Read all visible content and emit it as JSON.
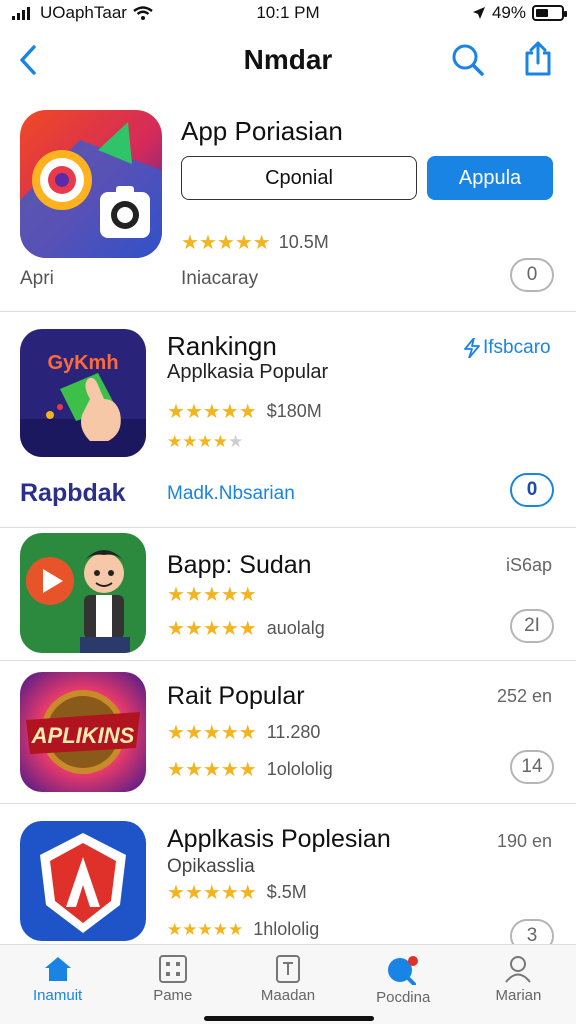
{
  "status_bar": {
    "carrier": "UOaphTaar",
    "time": "10:1 PM",
    "battery_percent": "49%",
    "battery_level": 0.49
  },
  "nav": {
    "title": "Nmdar",
    "back_icon": "chevron-left-icon",
    "search_icon": "search-icon",
    "share_icon": "share-icon"
  },
  "featured": {
    "title": "App Poriasian",
    "secondary_button": "Cponial",
    "primary_button": "Appula",
    "rating": 4.5,
    "size": "10.5M",
    "caption": "Apri",
    "category": "Iniacaray",
    "badge": "0"
  },
  "ranking": {
    "title": "Rankingn",
    "subtitle": "Applkasia Popular",
    "rating_primary": 5,
    "size": "$180M",
    "rating_secondary": 3.5,
    "link": "Ifsbcaro",
    "brand": "Rapbdak",
    "label": "Madk.Nbsarian",
    "badge": "0",
    "icon_text": "GyKmh"
  },
  "apps": [
    {
      "title": "Bapp: Sudan",
      "side": "iS6ap",
      "rating_primary": 4.5,
      "rating_secondary": 4.5,
      "subtitle": "auolalg",
      "badge": "2I"
    },
    {
      "title": "Rait Popular",
      "side": "252 en",
      "rating_primary": 4.5,
      "rating_secondary": 4.5,
      "detail": "11.280",
      "subtitle": "1olololig",
      "badge": "14",
      "icon_text": "APLIKINS"
    },
    {
      "title": "Applkasis Poplesian",
      "side": "190 en",
      "subtitle_top": "Opikasslia",
      "rating_primary": 5,
      "detail": "$.5M",
      "rating_secondary": 4.5,
      "subtitle": "1hlololig",
      "badge": "3"
    }
  ],
  "tabs": [
    {
      "label": "Inamuit",
      "icon": "home-icon",
      "active": true
    },
    {
      "label": "Pame",
      "icon": "grid-icon",
      "active": false
    },
    {
      "label": "Maadan",
      "icon": "document-icon",
      "active": false
    },
    {
      "label": "Pocdina",
      "icon": "search-icon",
      "active": false
    },
    {
      "label": "Marian",
      "icon": "person-icon",
      "active": false
    }
  ],
  "colors": {
    "accent": "#1a84e4",
    "star": "#f2b51f",
    "brand": "#2b2f8a"
  }
}
